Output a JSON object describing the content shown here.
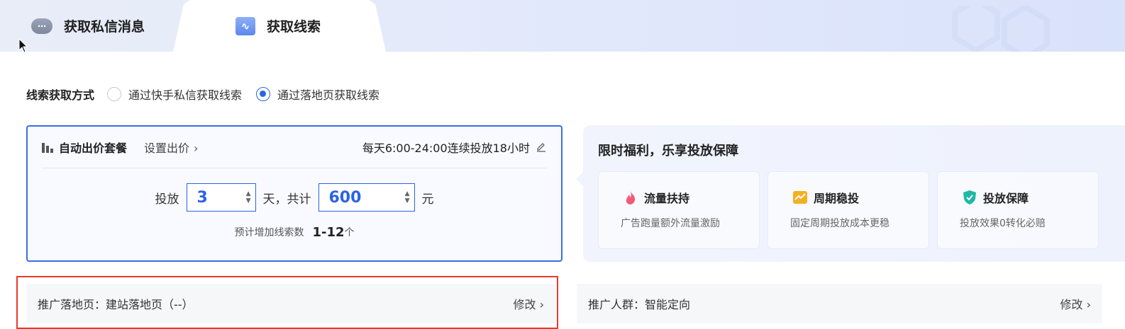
{
  "tabs": {
    "private_msg": {
      "label": "获取私信消息",
      "icon": "chat-bubble-icon"
    },
    "leads": {
      "label": "获取线索",
      "icon": "lead-icon"
    }
  },
  "method": {
    "label": "线索获取方式",
    "options": [
      {
        "label": "通过快手私信获取线索",
        "checked": false
      },
      {
        "label": "通过落地页获取线索",
        "checked": true
      }
    ]
  },
  "package": {
    "title": "自动出价套餐",
    "set_price": "设置出价",
    "schedule": "每天6:00-24:00连续投放18小时",
    "deliver_label": "投放",
    "days": "3",
    "days_unit": "天，共计",
    "budget": "600",
    "budget_unit": "元",
    "estimate_label": "预计增加线索数",
    "estimate_value": "1-12",
    "estimate_unit": "个"
  },
  "benefits": {
    "title": "限时福利，乐享投放保障",
    "items": [
      {
        "name": "流量扶持",
        "desc": "广告跑量额外流量激励",
        "icon": "fire-icon",
        "color": "#f25a7a"
      },
      {
        "name": "周期稳投",
        "desc": "固定周期投放成本更稳",
        "icon": "trend-chart-icon",
        "color": "#f5b020"
      },
      {
        "name": "投放保障",
        "desc": "投放效果0转化必赔",
        "icon": "shield-check-icon",
        "color": "#1fb8a6"
      }
    ]
  },
  "bottom": {
    "landing": {
      "label": "推广落地页：建站落地页（--）",
      "edit": "修改"
    },
    "audience": {
      "label": "推广人群：智能定向",
      "edit": "修改"
    }
  },
  "colors": {
    "accent": "#2a63e6",
    "highlight_border": "#e8382b"
  }
}
